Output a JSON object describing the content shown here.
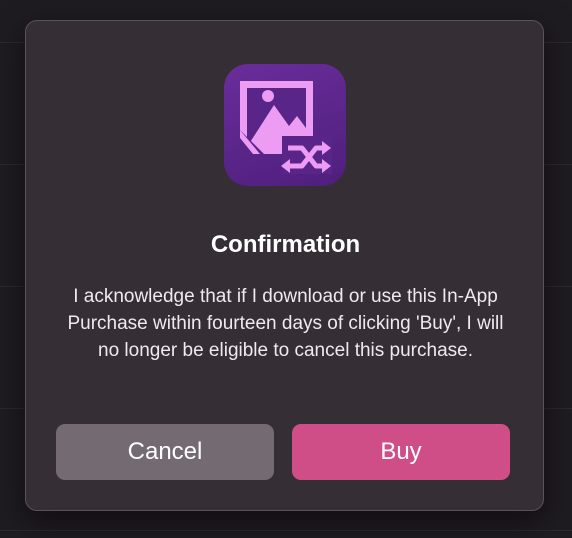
{
  "dialog": {
    "title": "Confirmation",
    "message": "I acknowledge that if I download or use this In-App Purchase within fourteen days of clicking 'Buy', I will no longer be eligible to cancel this purchase.",
    "icon": "image-convert-app-icon"
  },
  "buttons": {
    "cancel_label": "Cancel",
    "buy_label": "Buy"
  },
  "colors": {
    "accent": "#cf4e87",
    "cancel_button": "#736a72",
    "dialog_background": "#352e34",
    "icon_background": "#5a2588",
    "icon_glyph": "#ec9cf3"
  }
}
